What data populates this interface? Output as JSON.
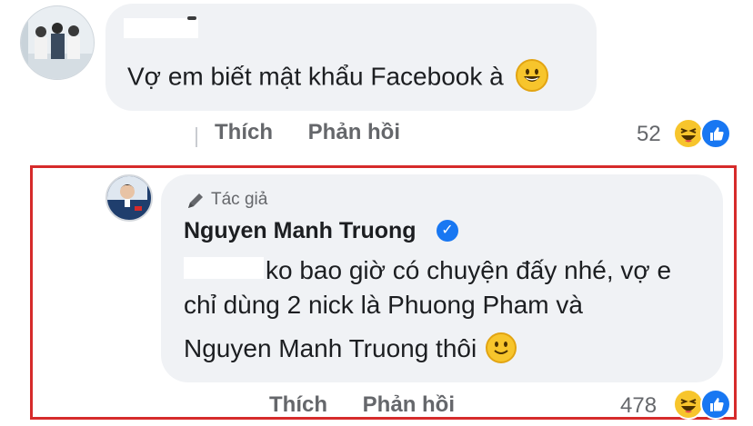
{
  "comment": {
    "text": "Vợ em biết mật khẩu Facebook à",
    "emoji_icon": "grinning-face-icon",
    "actions": {
      "like_label": "Thích",
      "reply_label": "Phản hồi"
    },
    "reaction_count": "52",
    "reaction_icons": [
      "haha-icon",
      "like-icon"
    ]
  },
  "reply": {
    "badge_label": "Tác giả",
    "author_name": "Nguyen Manh Truong",
    "verified_icon": "verified-badge-icon",
    "lines": [
      "ko bao giờ có chuyện đấy nhé, vợ e",
      "chỉ dùng 2 nick là Phuong Pham và",
      "Nguyen Manh Truong thôi"
    ],
    "emoji_icon": "slightly-smiling-face-icon",
    "actions": {
      "like_label": "Thích",
      "reply_label": "Phản hồi"
    },
    "reaction_count": "478",
    "reaction_icons": [
      "haha-icon",
      "like-icon"
    ]
  },
  "colors": {
    "highlight_border": "#d62b2b",
    "bubble_bg": "#f0f2f5",
    "secondary_text": "#65676b",
    "facebook_blue": "#1877f2"
  }
}
